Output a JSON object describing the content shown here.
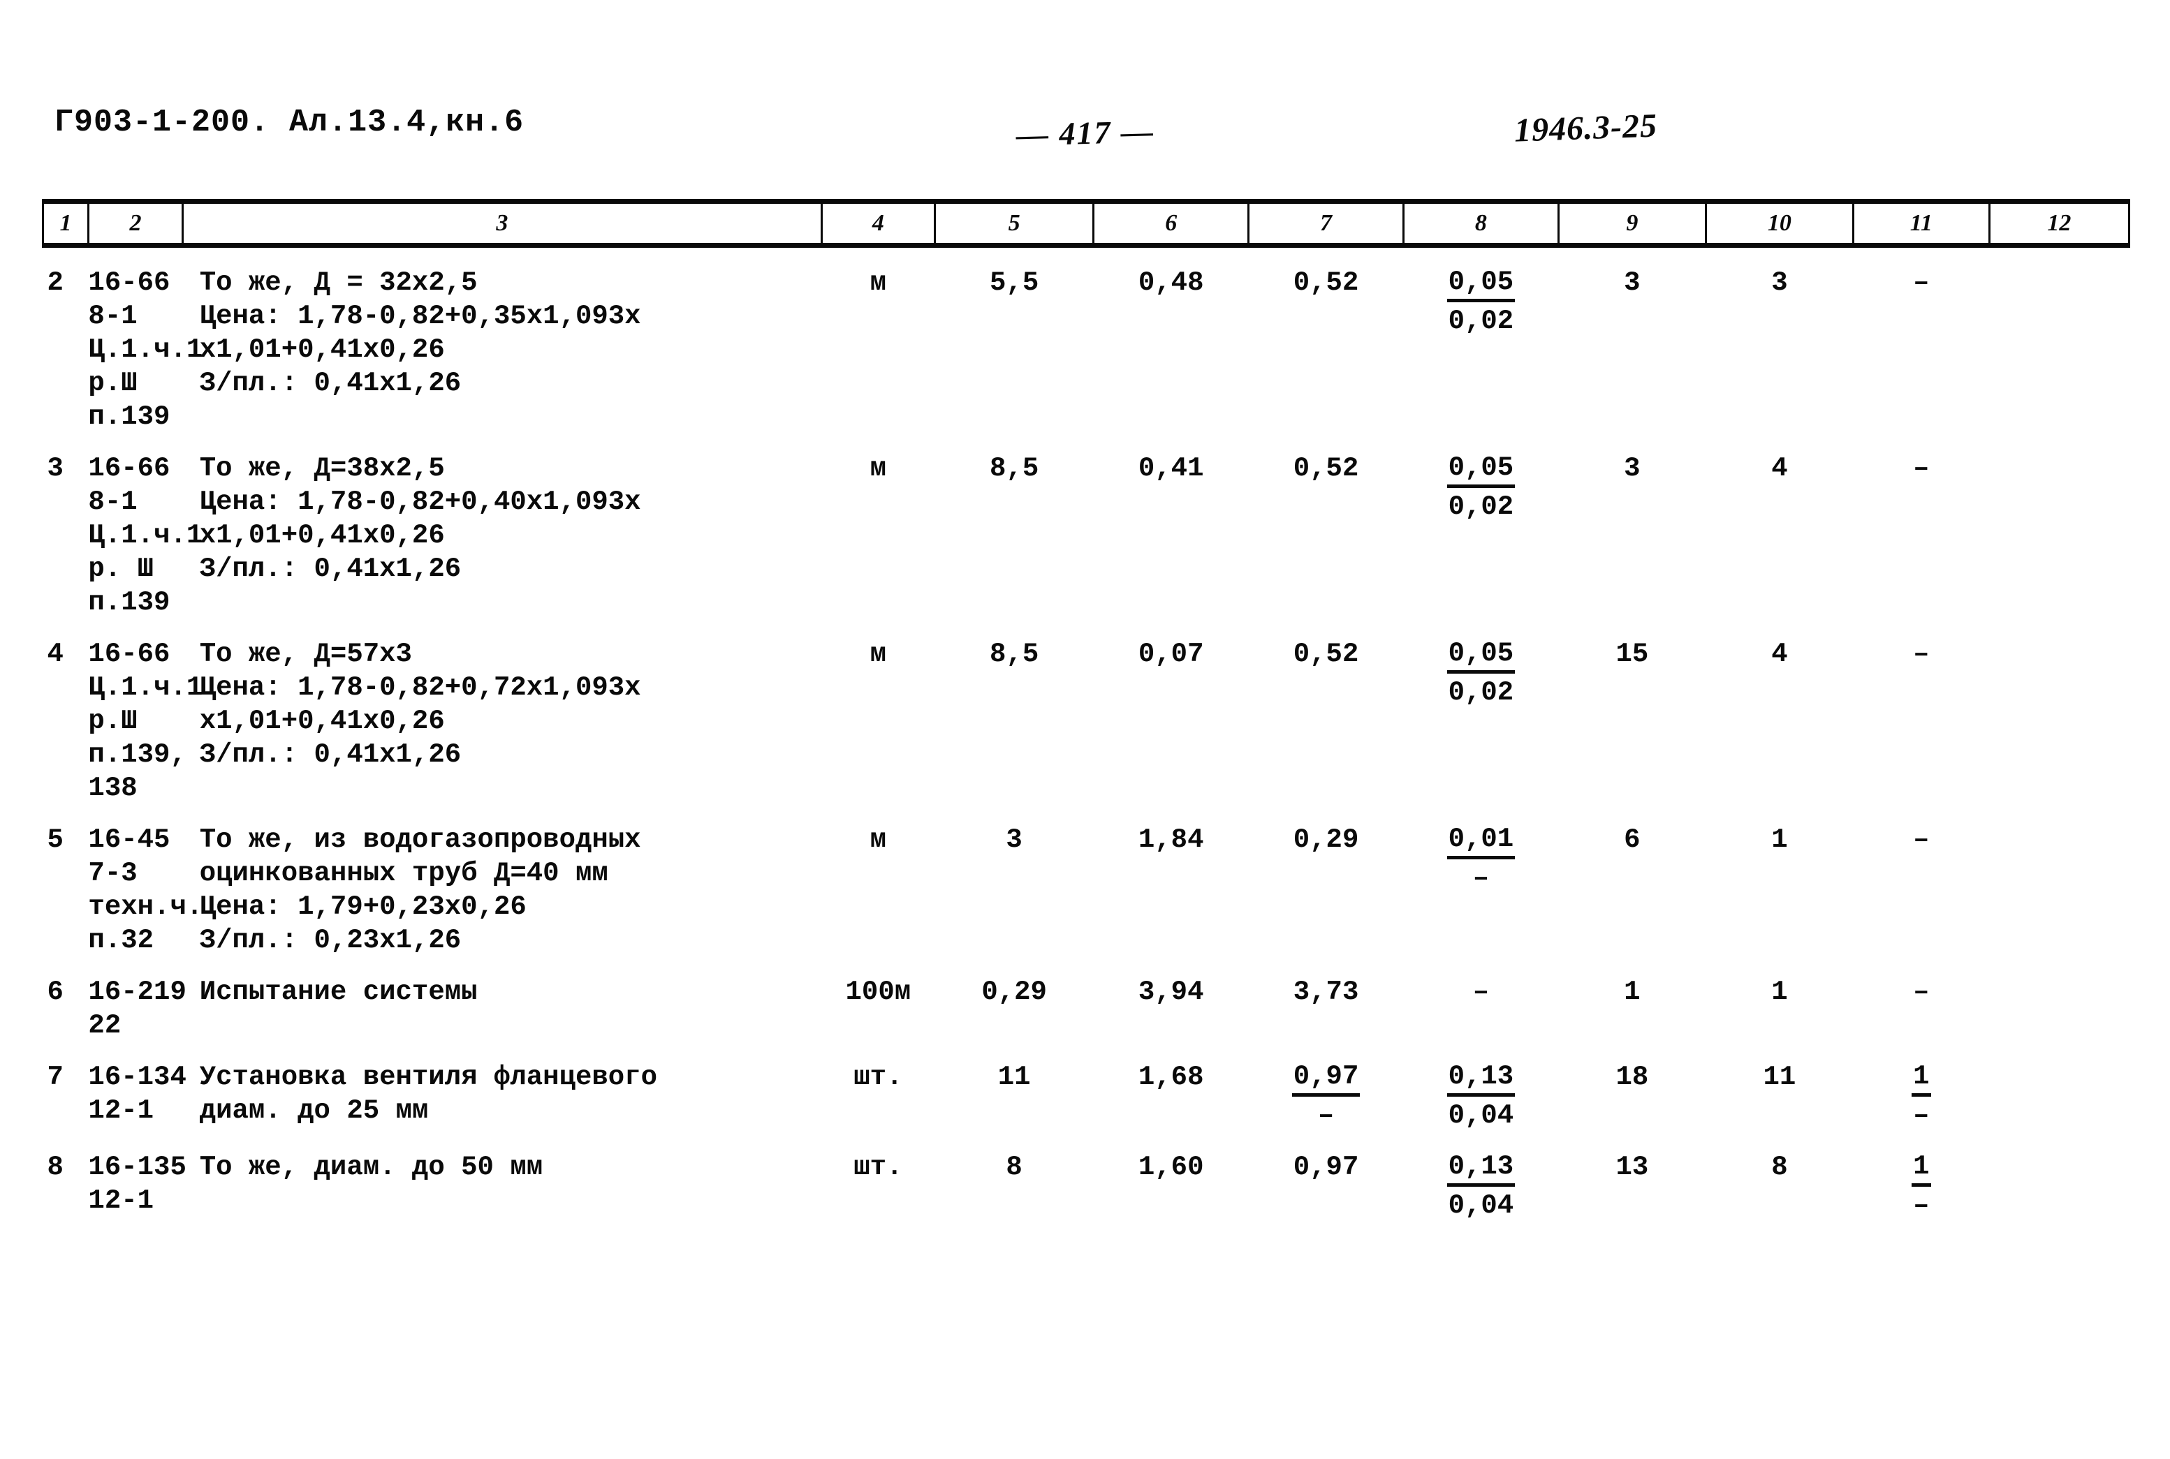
{
  "header": {
    "doc_code": "Г903-1-200. Ал.13.4,кн.6",
    "folio": "— 417 —",
    "stamp": "1946.3-25"
  },
  "table": {
    "column_headers": [
      "1",
      "2",
      "3",
      "4",
      "5",
      "6",
      "7",
      "8",
      "9",
      "10",
      "11",
      "12"
    ],
    "rows": [
      {
        "num": "2",
        "code": "16-66\n8-1\nЦ.1.ч.1\nр.Ш\nп.139",
        "desc": "То же, Д = 32x2,5\nЦена: 1,78-0,82+0,35x1,093x\nx1,01+0,41x0,26\nЗ/пл.: 0,41x1,26",
        "unit": "м",
        "c5": "5,5",
        "c6": "0,48",
        "c7": "0,52",
        "c8_num": "0,05",
        "c8_den": "0,02",
        "c9": "3",
        "c10": "3",
        "c11": "–",
        "c12": ""
      },
      {
        "num": "3",
        "code": "16-66\n8-1\nЦ.1.ч.1\nр. Ш\nп.139",
        "desc": "То же, Д=38x2,5\nЦена: 1,78-0,82+0,40x1,093x\nx1,01+0,41x0,26\nЗ/пл.: 0,41x1,26",
        "unit": "м",
        "c5": "8,5",
        "c6": "0,41",
        "c7": "0,52",
        "c8_num": "0,05",
        "c8_den": "0,02",
        "c9": "3",
        "c10": "4",
        "c11": "–",
        "c12": ""
      },
      {
        "num": "4",
        "code": "16-66\nЦ.1.ч.1\nр.Ш\nп.139,\n138",
        "desc": "То же, Д=57x3\nЦена: 1,78-0,82+0,72x1,093x\nx1,01+0,41x0,26\nЗ/пл.: 0,41x1,26",
        "unit": "м",
        "c5": "8,5",
        "c6": "0,07",
        "c7": "0,52",
        "c8_num": "0,05",
        "c8_den": "0,02",
        "c9": "15",
        "c10": "4",
        "c11": "–",
        "c12": ""
      },
      {
        "num": "5",
        "code": "16-45\n7-3\nтехн.ч.\nп.32",
        "desc": "То же, из водогазопроводных\nоцинкованных труб Д=40 мм\nЦена: 1,79+0,23x0,26\nЗ/пл.: 0,23x1,26",
        "unit": "м",
        "c5": "3",
        "c6": "1,84",
        "c7": "0,29",
        "c8_num": "0,01",
        "c8_den": "–",
        "c9": "6",
        "c10": "1",
        "c11": "–",
        "c12": ""
      },
      {
        "num": "6",
        "code": "16-219\n22",
        "desc": "Испытание системы",
        "unit": "100м",
        "c5": "0,29",
        "c6": "3,94",
        "c7": "3,73",
        "c8_num": "–",
        "c8_den": "",
        "c9": "1",
        "c10": "1",
        "c11": "–",
        "c12": ""
      },
      {
        "num": "7",
        "code": "16-134\n12-1",
        "desc": "Установка вентиля фланцевого\nдиам. до 25 мм",
        "unit": "шт.",
        "c5": "11",
        "c6": "1,68",
        "c7_num": "0,97",
        "c7_den": "–",
        "c8_num": "0,13",
        "c8_den": "0,04",
        "c9": "18",
        "c10": "11",
        "c11_num": "1",
        "c11_den": "–",
        "c12": ""
      },
      {
        "num": "8",
        "code": "16-135\n12-1",
        "desc": "То же, диам. до 50 мм",
        "unit": "шт.",
        "c5": "8",
        "c6": "1,60",
        "c7": "0,97",
        "c8_num": "0,13",
        "c8_den": "0,04",
        "c9": "13",
        "c10": "8",
        "c11_num": "1",
        "c11_den": "–",
        "c12": ""
      }
    ]
  }
}
